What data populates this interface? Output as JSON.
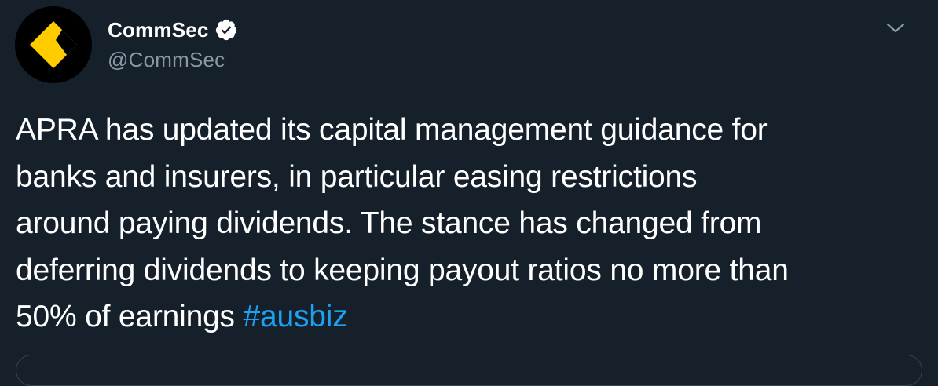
{
  "author": {
    "display_name": "CommSec",
    "handle": "@CommSec",
    "verified": true,
    "avatar_icon": "commbank-diamond-logo-icon"
  },
  "tweet": {
    "text_segments": [
      "APRA has updated its capital management guidance for",
      "banks and insurers, in particular easing restrictions",
      "around paying dividends. The stance has changed from",
      "deferring dividends to keeping payout ratios no more than",
      "50% of earnings "
    ],
    "hashtag": "#ausbiz"
  },
  "icons": {
    "verified": "verified-badge-icon",
    "menu": "chevron-down-icon"
  },
  "colors": {
    "background": "#15202b",
    "text_primary": "#ffffff",
    "text_secondary": "#8899a6",
    "accent": "#1da1f2",
    "logo_yellow": "#ffcc00"
  }
}
